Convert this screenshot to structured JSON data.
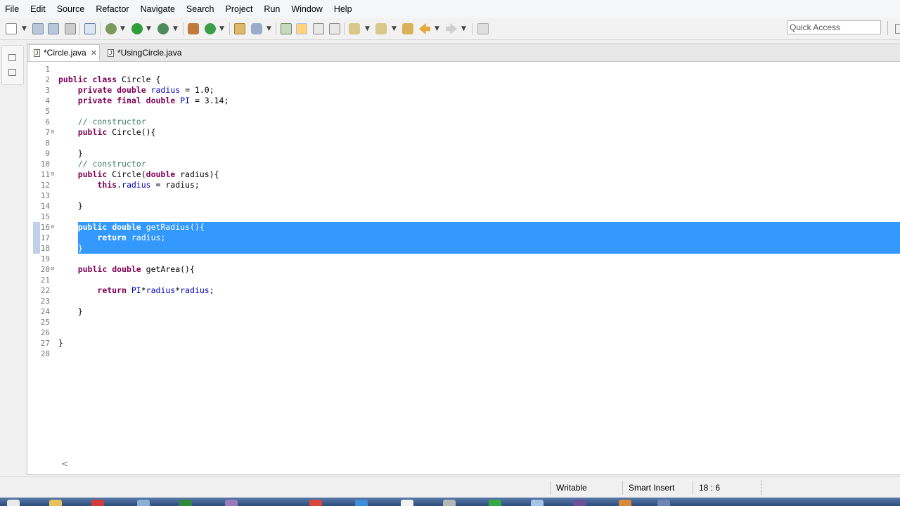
{
  "menu": [
    "File",
    "Edit",
    "Source",
    "Refactor",
    "Navigate",
    "Search",
    "Project",
    "Run",
    "Window",
    "Help"
  ],
  "toolbar": {
    "quick_access_placeholder": "Quick Access"
  },
  "tabs": [
    {
      "label": "*Circle.java",
      "active": true
    },
    {
      "label": "*UsingCircle.java",
      "active": false
    }
  ],
  "code_lines": [
    {
      "n": "1",
      "text": ""
    },
    {
      "n": "2",
      "text": "public class Circle {"
    },
    {
      "n": "3",
      "text": "    private double radius = 1.0;"
    },
    {
      "n": "4",
      "text": "    private final double PI = 3.14;"
    },
    {
      "n": "5",
      "text": ""
    },
    {
      "n": "6",
      "text": "    // constructor"
    },
    {
      "n": "7",
      "text": "    public Circle(){"
    },
    {
      "n": "8",
      "text": ""
    },
    {
      "n": "9",
      "text": "    }"
    },
    {
      "n": "10",
      "text": "    // constructor"
    },
    {
      "n": "11",
      "text": "    public Circle(double radius){"
    },
    {
      "n": "12",
      "text": "        this.radius = radius;"
    },
    {
      "n": "13",
      "text": ""
    },
    {
      "n": "14",
      "text": "    }"
    },
    {
      "n": "15",
      "text": ""
    },
    {
      "n": "16",
      "text": "    public double getRadius(){"
    },
    {
      "n": "17",
      "text": "        return radius;"
    },
    {
      "n": "18",
      "text": "    }"
    },
    {
      "n": "19",
      "text": ""
    },
    {
      "n": "20",
      "text": "    public double getArea(){"
    },
    {
      "n": "21",
      "text": ""
    },
    {
      "n": "22",
      "text": "        return PI*radius*radius;"
    },
    {
      "n": "23",
      "text": ""
    },
    {
      "n": "24",
      "text": "    }"
    },
    {
      "n": "25",
      "text": ""
    },
    {
      "n": "26",
      "text": ""
    },
    {
      "n": "27",
      "text": "}"
    },
    {
      "n": "28",
      "text": ""
    }
  ],
  "selected_lines": [
    "16",
    "17",
    "18"
  ],
  "fold_lines": [
    "7",
    "11",
    "16",
    "20"
  ],
  "status": {
    "mode": "Writable",
    "insert": "Smart Insert",
    "position": "18 : 6"
  },
  "colors": {
    "keyword": "#7f0055",
    "comment": "#3f7f5f",
    "field": "#0000c0",
    "selection": "#3399ff"
  }
}
